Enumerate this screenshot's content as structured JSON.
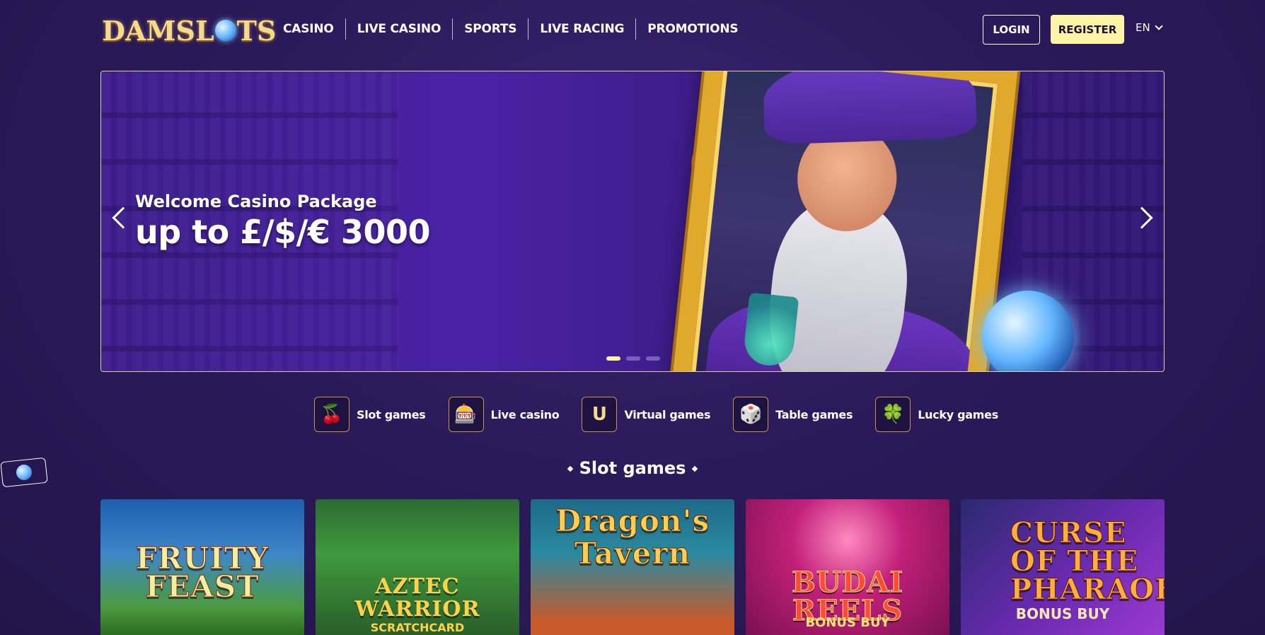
{
  "header": {
    "logo_text": "DAMSLOTS",
    "nav": [
      "CASINO",
      "LIVE CASINO",
      "SPORTS",
      "LIVE RACING",
      "PROMOTIONS"
    ],
    "login_label": "LOGIN",
    "register_label": "REGISTER",
    "language": "EN"
  },
  "banner": {
    "subtitle": "Welcome Casino Package",
    "title": "up to £/$/€ 3000",
    "slides": 3,
    "active_slide": 1
  },
  "categories": [
    {
      "label": "Slot games",
      "icon": "cherries-icon"
    },
    {
      "label": "Live casino",
      "icon": "chips-icon"
    },
    {
      "label": "Virtual games",
      "icon": "horseshoe-icon"
    },
    {
      "label": "Table games",
      "icon": "dice-icon"
    },
    {
      "label": "Lucky games",
      "icon": "clover-icon"
    }
  ],
  "section": {
    "title": "Slot games"
  },
  "games": [
    {
      "name": "FRUITY FEAST",
      "sub": ""
    },
    {
      "name": "AZTEC WARRIOR",
      "sub": "SCRATCHCARD"
    },
    {
      "name": "Dragon's Tavern",
      "sub": ""
    },
    {
      "name": "BUDAI REELS",
      "sub": "BONUS BUY"
    },
    {
      "name": "CURSE OF THE PHARAOH",
      "sub": "BONUS BUY"
    }
  ],
  "colors": {
    "background": "#2b1a5a",
    "register_bg": "#fff3a6",
    "accent_gold": "#e1a92c"
  }
}
